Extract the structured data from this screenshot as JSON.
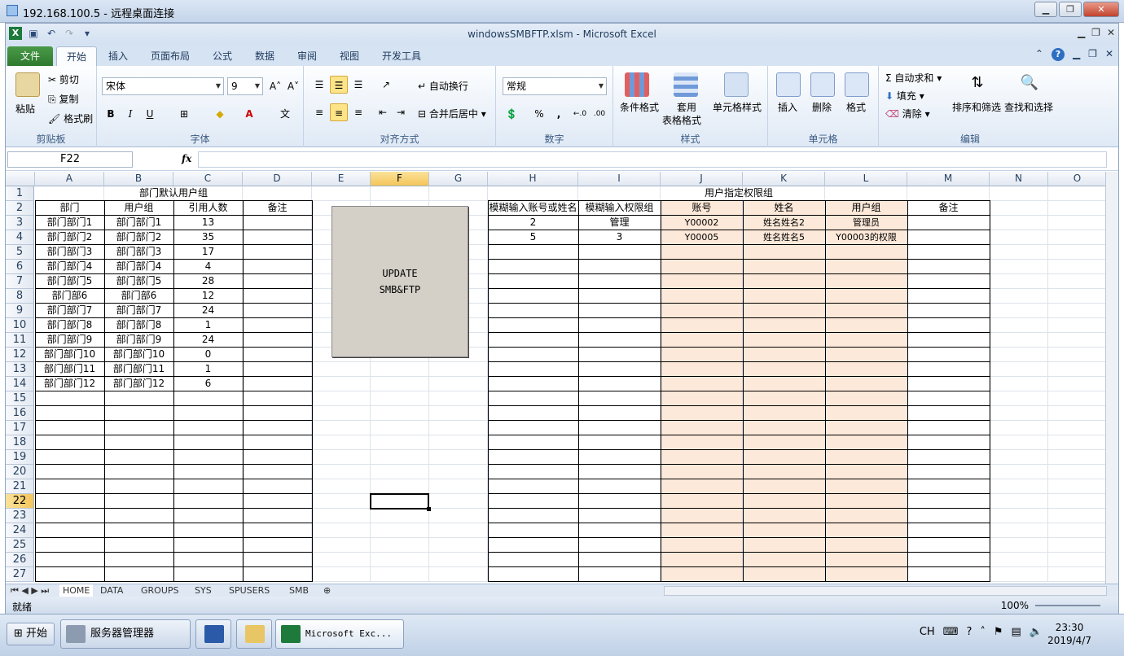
{
  "rdp": {
    "title": "192.168.100.5 - 远程桌面连接"
  },
  "excel": {
    "doc_title": "windowsSMBFTP.xlsm  -  Microsoft Excel",
    "tabs": [
      "文件",
      "开始",
      "插入",
      "页面布局",
      "公式",
      "数据",
      "审阅",
      "视图",
      "开发工具"
    ],
    "ribbon": {
      "clipboard": {
        "label": "剪贴板",
        "paste": "粘贴",
        "cut": "剪切",
        "copy": "复制",
        "format_painter": "格式刷"
      },
      "font": {
        "label": "字体",
        "name": "宋体",
        "size": "9",
        "bold": "B",
        "italic": "I",
        "underline": "U"
      },
      "alignment": {
        "label": "对齐方式",
        "wrap": "自动换行",
        "merge": "合并后居中"
      },
      "number": {
        "label": "数字",
        "format": "常规",
        "percent": "%",
        "comma": ","
      },
      "styles": {
        "label": "样式",
        "cond": "条件格式",
        "table1": "套用",
        "table2": "表格格式",
        "cell": "单元格样式"
      },
      "cells": {
        "label": "单元格",
        "insert": "插入",
        "delete": "删除",
        "format": "格式"
      },
      "editing": {
        "label": "编辑",
        "autosum": "自动求和",
        "fill": "填充",
        "clear": "清除",
        "sort": "排序和筛选",
        "find": "查找和选择"
      }
    },
    "name_box": "F22",
    "fx": "fx"
  },
  "grid": {
    "columns": [
      "A",
      "B",
      "C",
      "D",
      "E",
      "F",
      "G",
      "H",
      "I",
      "J",
      "K",
      "L",
      "M",
      "N",
      "O"
    ],
    "rows": [
      "1",
      "2",
      "3",
      "4",
      "5",
      "6",
      "7",
      "8",
      "9",
      "10",
      "11",
      "12",
      "13",
      "14",
      "15",
      "16",
      "17",
      "18",
      "19",
      "20",
      "21",
      "22",
      "23",
      "24",
      "25",
      "26",
      "27"
    ],
    "left_table": {
      "title": "部门默认用户组",
      "headers": [
        "部门",
        "用户组",
        "引用人数",
        "备注"
      ],
      "rows": [
        [
          "部门部门1",
          "部门部门1",
          "13",
          ""
        ],
        [
          "部门部门2",
          "部门部门2",
          "35",
          ""
        ],
        [
          "部门部门3",
          "部门部门3",
          "17",
          ""
        ],
        [
          "部门部门4",
          "部门部门4",
          "4",
          ""
        ],
        [
          "部门部门5",
          "部门部门5",
          "28",
          ""
        ],
        [
          "部门部6",
          "部门部6",
          "12",
          ""
        ],
        [
          "部门部门7",
          "部门部门7",
          "24",
          ""
        ],
        [
          "部门部门8",
          "部门部门8",
          "1",
          ""
        ],
        [
          "部门部门9",
          "部门部门9",
          "24",
          ""
        ],
        [
          "部门部门10",
          "部门部门10",
          "0",
          ""
        ],
        [
          "部门部门11",
          "部门部门11",
          "1",
          ""
        ],
        [
          "部门部门12",
          "部门部门12",
          "6",
          ""
        ]
      ]
    },
    "right_table": {
      "title": "用户指定权限组",
      "headers": [
        "模糊输入账号或姓名",
        "模糊输入权限组",
        "账号",
        "姓名",
        "用户组",
        "备注"
      ],
      "rows": [
        [
          "2",
          "管理",
          "Y00002",
          "姓名姓名2",
          "管理员",
          ""
        ],
        [
          "5",
          "3",
          "Y00005",
          "姓名姓名5",
          "Y00003的权限",
          ""
        ]
      ]
    },
    "macro_button": {
      "line1": "UPDATE",
      "line2": "SMB&FTP"
    }
  },
  "sheet_tabs": [
    "HOME",
    "DATA",
    "GROUPS",
    "SYS",
    "SPUSERS",
    "SMB"
  ],
  "status": {
    "ready": "就绪",
    "zoom": "100%"
  },
  "taskbar": {
    "start": "开始",
    "server_manager": "服务器管理器",
    "excel_task": "Microsoft Exc...",
    "lang": "CH",
    "time": "23:30",
    "date": "2019/4/7"
  }
}
